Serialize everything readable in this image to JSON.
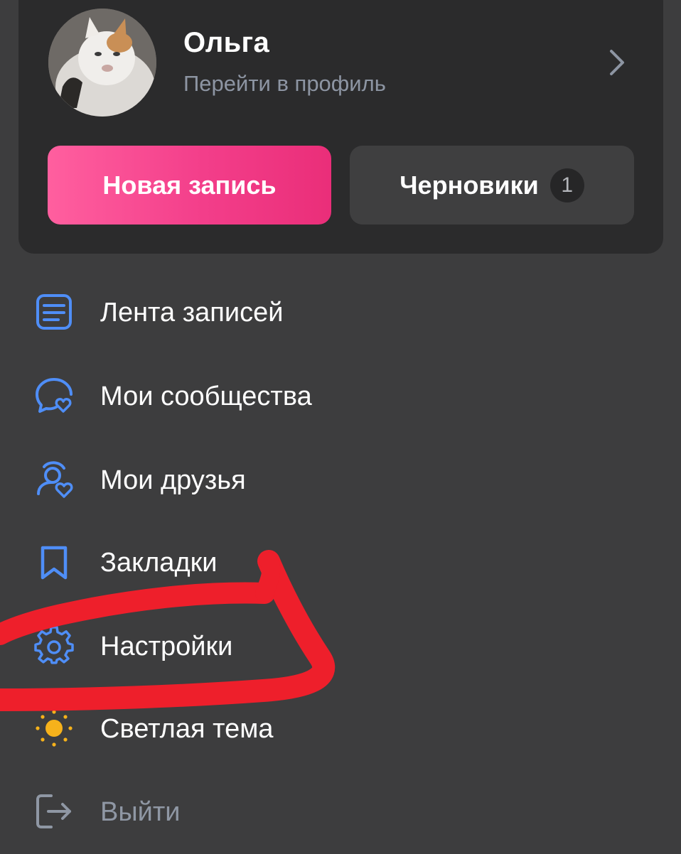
{
  "profile": {
    "name": "Ольга",
    "subtitle": "Перейти в профиль"
  },
  "actions": {
    "new_post": "Новая запись",
    "drafts": "Черновики",
    "drafts_count": "1"
  },
  "menu": [
    {
      "label": "Лента записей",
      "icon": "feed-icon"
    },
    {
      "label": "Мои сообщества",
      "icon": "communities-icon"
    },
    {
      "label": "Мои друзья",
      "icon": "friends-icon"
    },
    {
      "label": "Закладки",
      "icon": "bookmark-icon"
    },
    {
      "label": "Настройки",
      "icon": "gear-icon"
    },
    {
      "label": "Светлая тема",
      "icon": "sun-icon"
    },
    {
      "label": "Выйти",
      "icon": "logout-icon"
    }
  ],
  "colors": {
    "background": "#3d3d3e",
    "card": "#2b2b2c",
    "accent_pink": "#f33e8a",
    "icon_blue": "#4f8ef7",
    "sun": "#f6b21b",
    "annotation_red": "#ee1f2b"
  }
}
